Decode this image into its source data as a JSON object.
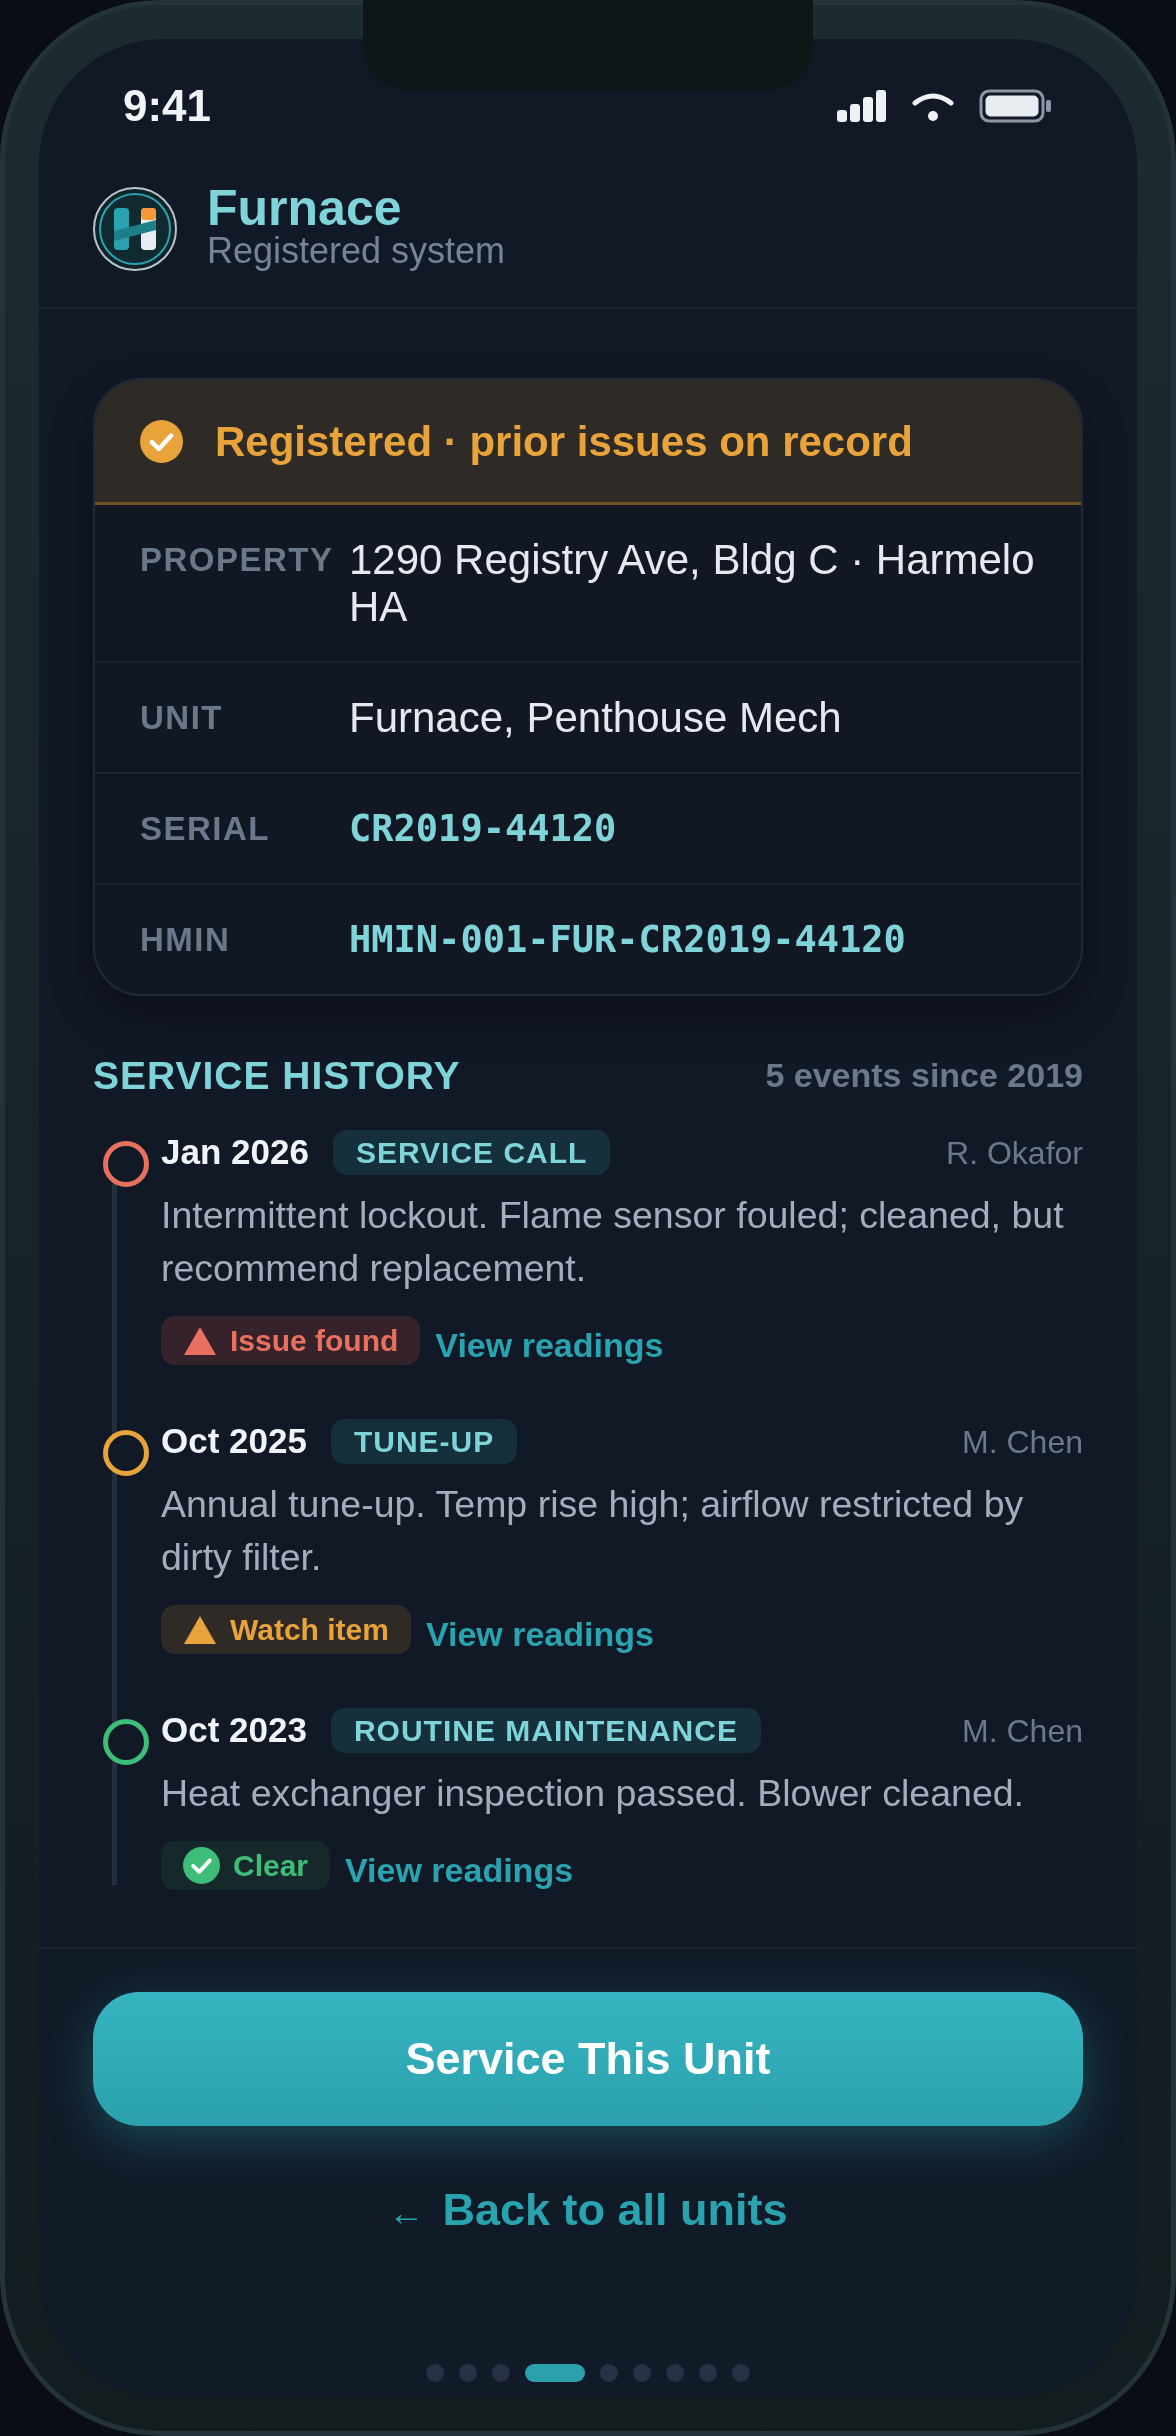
{
  "status_bar": {
    "time": "9:41"
  },
  "header": {
    "title": "Furnace",
    "subtitle": "Registered system"
  },
  "registration": {
    "kind": "caution",
    "banner": "Registered · prior issues on record",
    "fields": [
      {
        "label": "PROPERTY",
        "value": "1290 Registry Ave, Bldg C · Harmelo HA",
        "kind": "text"
      },
      {
        "label": "UNIT",
        "value": "Furnace, Penthouse Mech",
        "kind": "text"
      },
      {
        "label": "SERIAL",
        "value": "CR2019-44120",
        "kind": "code"
      },
      {
        "label": "HMIN",
        "value": "HMIN-001-FUR-CR2019-44120",
        "kind": "code"
      }
    ]
  },
  "service_history": {
    "title": "SERVICE HISTORY",
    "summary": "5 events since 2019",
    "events": [
      {
        "date": "Jan 2026",
        "type": "SERVICE CALL",
        "technician": "R. Okafor",
        "description": "Intermittent lockout. Flame sensor fouled; cleaned, but recommend replacement.",
        "color": "#e8705e",
        "badge": {
          "kind": "issue",
          "label": "Issue found"
        },
        "link": "View readings"
      },
      {
        "date": "Oct 2025",
        "type": "TUNE-UP",
        "technician": "M. Chen",
        "description": "Annual tune-up. Temp rise high; airflow restricted by dirty filter.",
        "color": "#e8a33a",
        "badge": {
          "kind": "watch",
          "label": "Watch item"
        },
        "link": "View readings"
      },
      {
        "date": "Oct 2023",
        "type": "ROUTINE MAINTENANCE",
        "technician": "M. Chen",
        "description": "Heat exchanger inspection passed. Blower cleaned.",
        "color": "#3dbd77",
        "badge": {
          "kind": "clear",
          "label": "Clear"
        },
        "link": "View readings"
      }
    ]
  },
  "primary_button": "Service This Unit",
  "back_link": {
    "arrow": "←",
    "label": "Back to all units"
  },
  "pager": [
    {
      "selected": false
    },
    {
      "selected": false
    },
    {
      "selected": false
    },
    {
      "selected": true
    },
    {
      "selected": false
    },
    {
      "selected": false
    },
    {
      "selected": false
    },
    {
      "selected": false
    },
    {
      "selected": false
    }
  ]
}
